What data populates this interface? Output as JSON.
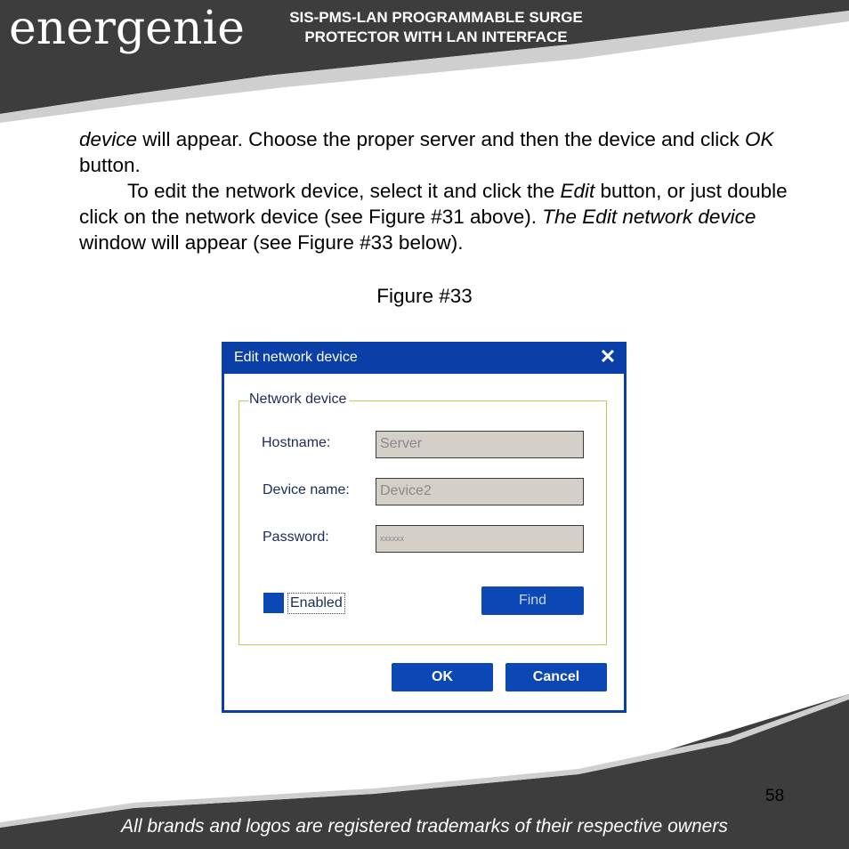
{
  "header": {
    "logo": "energenie",
    "title_line1": "SIS-PMS-LAN PROGRAMMABLE SURGE",
    "title_line2": "PROTECTOR WITH LAN INTERFACE"
  },
  "body": {
    "p1_em1": "device",
    "p1_t1": " will appear. Choose the proper server and then the device and click ",
    "p1_em2": "OK",
    "p1_t2": " button.",
    "p2_t1": "To edit the network device, select it and click the ",
    "p2_em1": "Edit",
    "p2_t2": " button, or just double click on the network device (see Figure #31 above). ",
    "p2_em2": "The Edit network device",
    "p2_t3": " window will appear (see Figure #33 below)."
  },
  "figure_caption": "Figure #33",
  "dialog": {
    "title": "Edit network device",
    "close_glyph": "✕",
    "group_label": "Network device",
    "hostname_label": "Hostname:",
    "hostname_value": "Server",
    "device_name_label": "Device name:",
    "device_name_value": "Device2",
    "password_label": "Password:",
    "password_value": "xxxxxx",
    "enabled_label": "Enabled",
    "find_label": "Find",
    "ok_label": "OK",
    "cancel_label": "Cancel"
  },
  "footer": {
    "page_number": "58",
    "note": "All brands and logos are registered trademarks of their respective owners"
  },
  "colors": {
    "header_dark": "#3d3d3d",
    "dialog_blue": "#0b3fa8",
    "group_border": "#b7cf5a"
  }
}
